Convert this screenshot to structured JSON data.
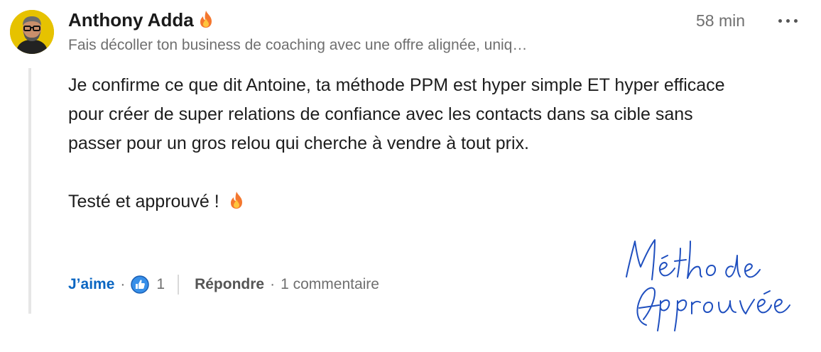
{
  "author": {
    "name": "Anthony Adda",
    "headline": "Fais décoller ton business de coaching avec une offre alignée, uniq…"
  },
  "timestamp": "58 min",
  "comment": {
    "paragraph1": "Je confirme ce que dit Antoine, ta méthode PPM est hyper simple ET hyper efficace pour créer de super relations de confiance avec les contacts dans sa cible sans passer pour un gros relou qui cherche à vendre à tout prix.",
    "paragraph2": "Testé et approuvé !"
  },
  "actions": {
    "like_label": "J’aime",
    "like_count": "1",
    "reply_label": "Répondre",
    "comments_count": "1 commentaire"
  },
  "signature": {
    "line1": "Méthode",
    "line2": "Approuvée"
  },
  "colors": {
    "like_blue": "#0a66c2",
    "signature_ink": "#1f4fbf",
    "avatar_bg": "#e6c200",
    "fire_orange": "#f4772e"
  },
  "icons": [
    "fire-icon",
    "like-icon",
    "more-icon"
  ]
}
